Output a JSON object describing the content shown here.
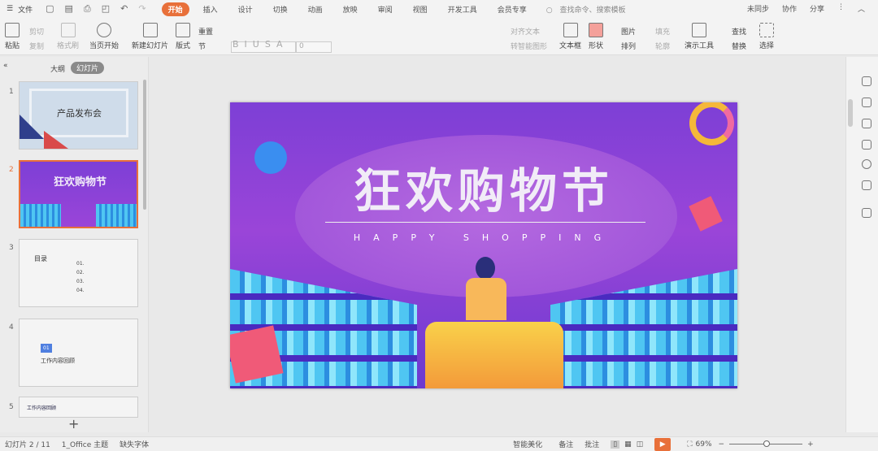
{
  "menubar": {
    "file": "文件",
    "tabs": [
      "开始",
      "插入",
      "设计",
      "切换",
      "动画",
      "放映",
      "审阅",
      "视图",
      "开发工具",
      "会员专享"
    ],
    "search_placeholder": "查找命令、搜索模板",
    "right": [
      "未同步",
      "协作",
      "分享"
    ]
  },
  "toolbar": {
    "paste": "粘贴",
    "cut": "剪切",
    "copy": "复制",
    "format_painter": "格式刷",
    "play_from_current": "当页开始",
    "new_slide": "新建幻灯片",
    "layout": "版式",
    "reset": "重置",
    "section": "节",
    "font_size": "0",
    "align_text": "对齐文本",
    "smartart": "转智能图形",
    "textbox": "文本框",
    "shape": "形状",
    "picture": "图片",
    "fill": "填充",
    "arrange": "排列",
    "outline": "轮廓",
    "present_tools": "演示工具",
    "find": "查找",
    "replace": "替换",
    "select": "选择"
  },
  "left_panel": {
    "tab_outline": "大纲",
    "tab_slides": "幻灯片",
    "thumbs": [
      {
        "num": "1",
        "title": "产品发布会"
      },
      {
        "num": "2",
        "title": "狂欢购物节"
      },
      {
        "num": "3",
        "title": "目录",
        "items": [
          "01.",
          "02.",
          "03.",
          "04."
        ]
      },
      {
        "num": "4",
        "badge": "01",
        "title": "工作内容回顾"
      },
      {
        "num": "5",
        "title": "工作内容回顾"
      }
    ],
    "add": "+"
  },
  "slide": {
    "title": "狂欢购物节",
    "subtitle": "HAPPY SHOPPING"
  },
  "status": {
    "slide_index": "幻灯片 2 / 11",
    "theme": "1_Office 主题",
    "missing_font": "缺失字体",
    "beautify": "智能美化",
    "notes": "备注",
    "comments": "批注",
    "zoom": "69%"
  },
  "colors": {
    "accent": "#e8703a",
    "slide_purple": "#7d3fd6"
  }
}
